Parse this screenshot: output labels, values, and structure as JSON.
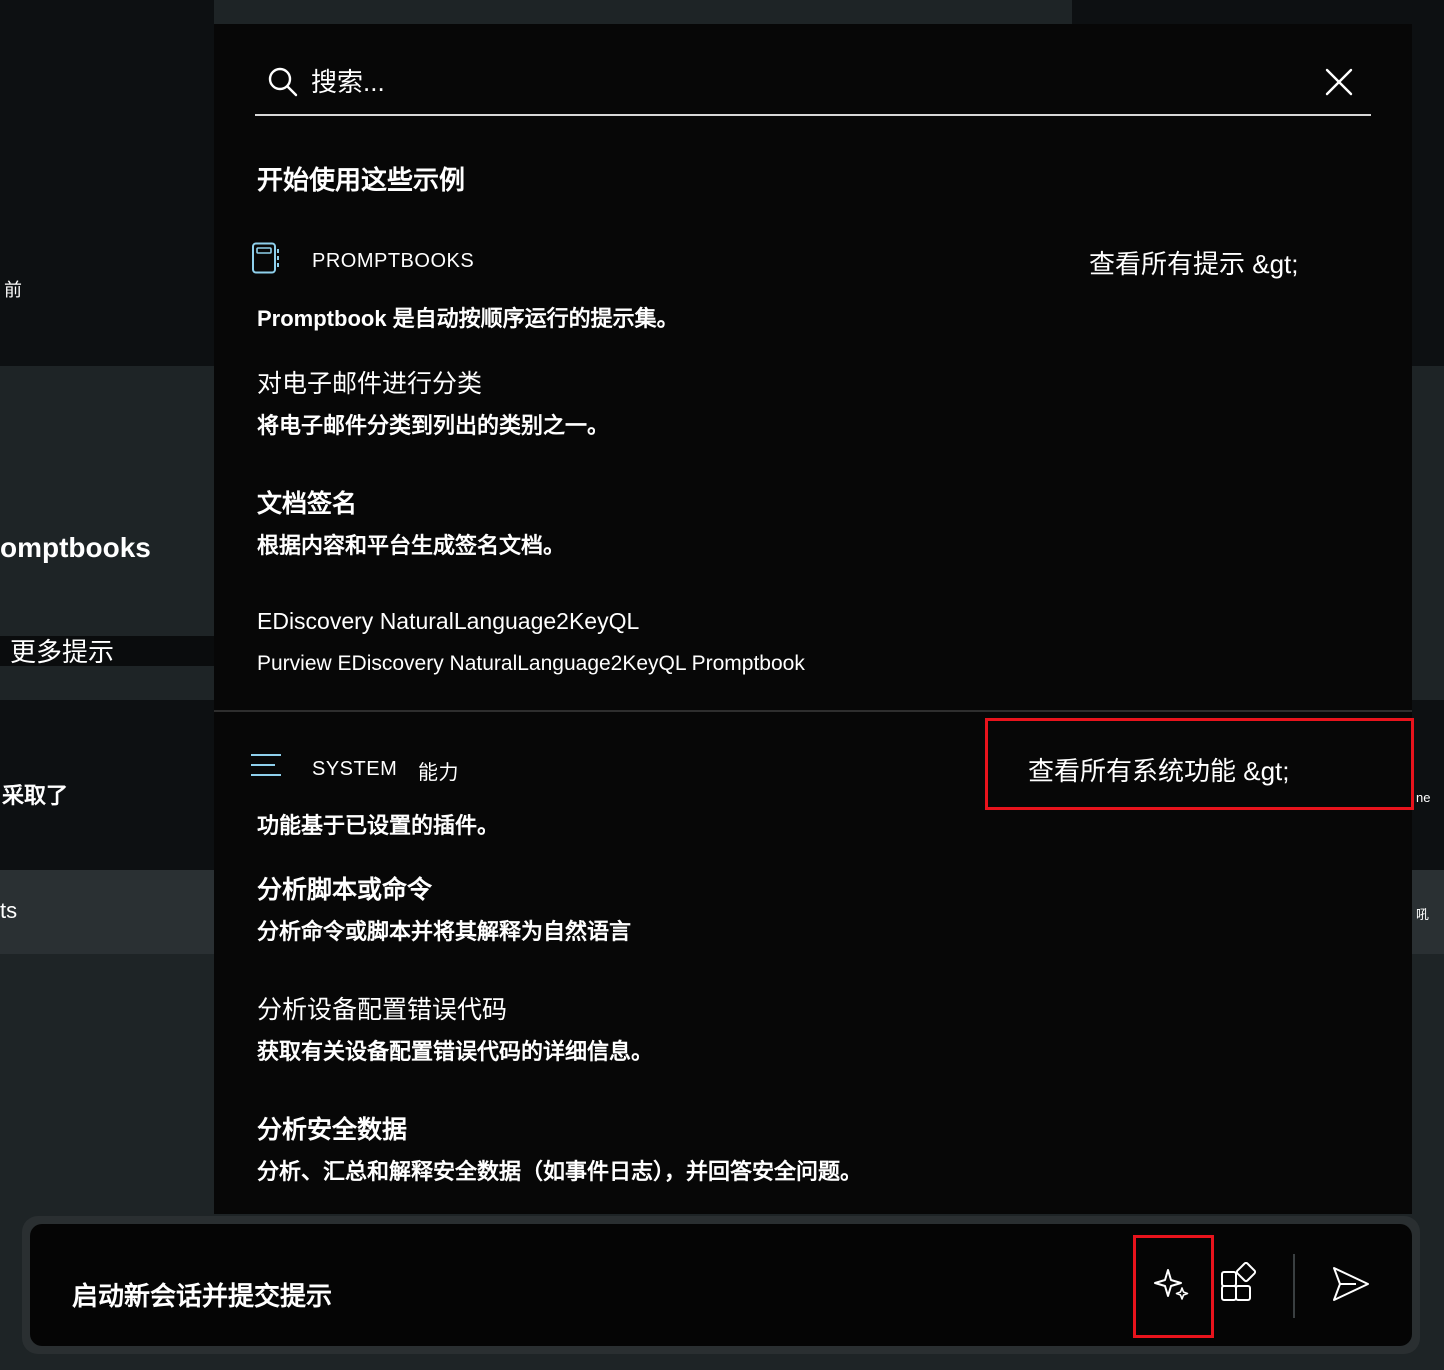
{
  "background": {
    "text_before": "前",
    "promptbooks_heading": "omptbooks",
    "more_prompts": "更多提示",
    "taken_text": "采取了",
    "its_text": "ts",
    "right_fragment_1": "ne",
    "right_fragment_2": "吼"
  },
  "search": {
    "placeholder": "搜索..."
  },
  "panel": {
    "intro_heading": "开始使用这些示例",
    "promptbooks_section": {
      "label": "PROMPTBOOKS",
      "view_all_link": "查看所有提示 &gt;",
      "description": "Promptbook 是自动按顺序运行的提示集。",
      "items": [
        {
          "title": "对电子邮件进行分类",
          "description": "将电子邮件分类到列出的类别之一。"
        },
        {
          "title": "文档签名",
          "description": "根据内容和平台生成签名文档。"
        },
        {
          "title": "EDiscovery NaturalLanguage2KeyQL",
          "description": "Purview EDiscovery NaturalLanguage2KeyQL Promptbook"
        }
      ]
    },
    "system_section": {
      "label": "SYSTEM",
      "label_suffix": "能力",
      "view_all_link": "查看所有系统功能 &gt;",
      "description": "功能基于已设置的插件。",
      "items": [
        {
          "title": "分析脚本或命令",
          "description": "分析命令或脚本并将其解释为自然语言"
        },
        {
          "title": "分析设备配置错误代码",
          "description": "获取有关设备配置错误代码的详细信息。"
        },
        {
          "title": "分析安全数据",
          "description": "分析、汇总和解释安全数据（如事件日志），并回答安全问题。"
        }
      ]
    }
  },
  "prompt_bar": {
    "text": "启动新会话并提交提示"
  },
  "colors": {
    "highlight_box": "#e8131c",
    "panel_bg": "#070707",
    "page_bg": "#1e2426"
  }
}
